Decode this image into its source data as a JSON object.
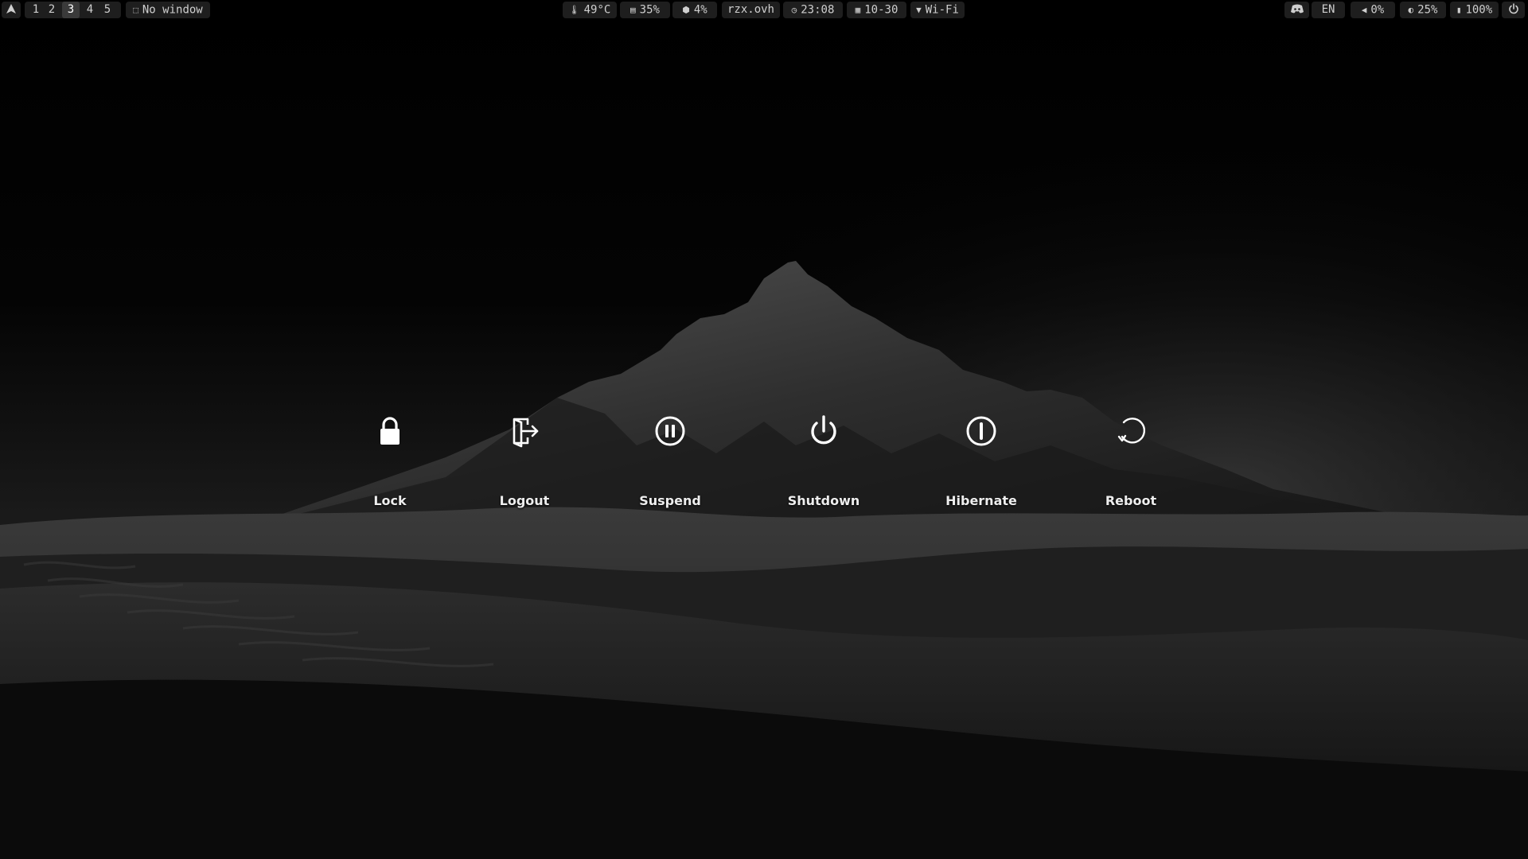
{
  "topbar": {
    "launcher_icon": "arch-logo-icon",
    "workspaces": [
      "1",
      "2",
      "3",
      "4",
      "5"
    ],
    "active_workspace": "3",
    "window_title": "No window",
    "temperature": "49°C",
    "memory": "35%",
    "cpu": "4%",
    "hostname": "rzx.ovh",
    "time": "23:08",
    "date": "10-30",
    "network": "Wi-Fi",
    "tray_icon": "discord-icon",
    "keyboard_layout": "EN",
    "volume": "0%",
    "brightness": "25%",
    "battery": "100%",
    "power_icon": "power-icon"
  },
  "power_menu": {
    "items": [
      {
        "label": "Lock",
        "icon": "lock-icon"
      },
      {
        "label": "Logout",
        "icon": "logout-icon"
      },
      {
        "label": "Suspend",
        "icon": "pause-circle-icon"
      },
      {
        "label": "Shutdown",
        "icon": "power-icon"
      },
      {
        "label": "Hibernate",
        "icon": "hibernate-icon"
      },
      {
        "label": "Reboot",
        "icon": "reboot-icon"
      }
    ]
  },
  "colors": {
    "bar_pill": "#1e1e1e",
    "active_workspace": "#3a3a3a",
    "text": "#d8d8d8",
    "icon": "#ffffff"
  }
}
